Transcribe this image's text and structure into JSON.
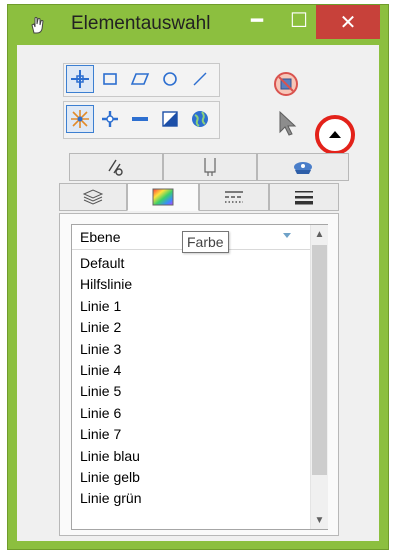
{
  "window": {
    "title": "Elementauswahl",
    "controls": {
      "minimize": "━",
      "maximize": "☐",
      "close": "✕"
    }
  },
  "toolbar": {
    "row1": [
      "crosshair-select-icon",
      "rectangle-icon",
      "parallelogram-icon",
      "circle-icon",
      "line-icon"
    ],
    "row2": [
      "star-select-icon",
      "plus-icon",
      "minus-icon",
      "invert-icon",
      "globe-icon"
    ],
    "selected_row1": "crosshair-select-icon"
  },
  "tabs": {
    "upper": [
      "attributes-tab-icon",
      "templates-tab-icon",
      "display-tab-icon"
    ],
    "lower": [
      "level-tab-icon",
      "color-tab-icon",
      "linestyle-tab-icon",
      "lineweight-tab-icon"
    ],
    "active_lower": "color-tab-icon"
  },
  "list": {
    "header": "Ebene",
    "tooltip": "Farbe",
    "items": [
      "Default",
      "Hilfslinie",
      "Linie 1",
      "Linie 2",
      "Linie 3",
      "Linie 4",
      "Linie 5",
      "Linie 6",
      "Linie 7",
      "Linie blau",
      "Linie gelb",
      "Linie grün"
    ]
  },
  "colors": {
    "window_border": "#8cbf3f",
    "close_button": "#c7413a",
    "highlight_circle": "#e3221a",
    "selection_blue": "#3c7fd1"
  }
}
